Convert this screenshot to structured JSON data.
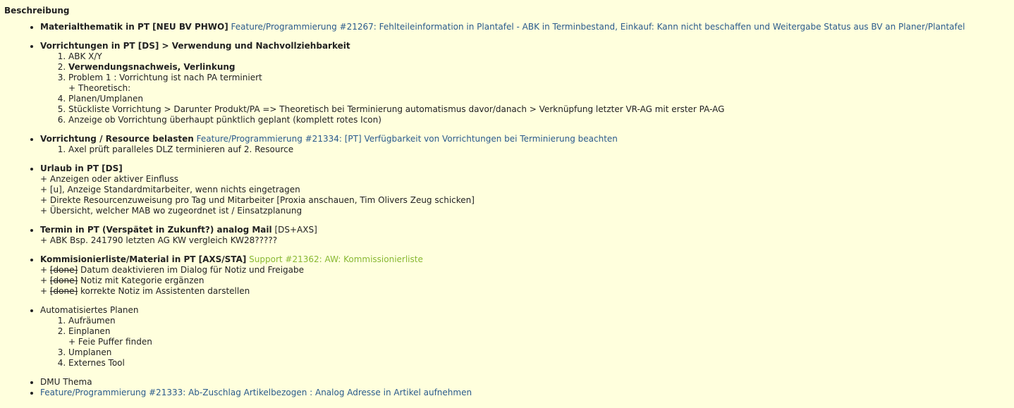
{
  "heading": "Beschreibung",
  "colors": {
    "background": "#ffffdd",
    "link": "#2a5a8c",
    "support_link": "#88b832",
    "text": "#222222"
  },
  "items": [
    {
      "bold": "Materialthematik in PT [NEU BV PHWO]",
      "link": "Feature/Programmierung #21267: Fehlteileinformation in Plantafel - ABK in Terminbestand, Einkauf: Kann nicht beschaffen und Weitergabe Status aus BV an Planer/Plantafel"
    },
    {
      "bold": "Vorrichtungen in PT [DS] > Verwendung und Nachvollziehbarkeit",
      "ol": [
        {
          "text": "ABK X/Y"
        },
        {
          "bold": "Verwendungsnachweis, Verlinkung"
        },
        {
          "text": "Problem 1 : Vorrichtung ist nach PA terminiert",
          "sub": "+ Theoretisch:"
        },
        {
          "text": "Planen/Umplanen"
        },
        {
          "text": "Stückliste Vorrichtung > Darunter Produkt/PA => Theoretisch bei Terminierung automatismus davor/danach > Verknüpfung letzter VR-AG mit erster PA-AG"
        },
        {
          "text": "Anzeige ob Vorrichtung überhaupt pünktlich geplant (komplett rotes Icon)"
        }
      ]
    },
    {
      "bold": "Vorrichtung / Resource belasten",
      "link": "Feature/Programmierung #21334: [PT] Verfügbarkeit von Vorrichtungen bei Terminierung beachten",
      "ol": [
        {
          "text": "Axel prüft paralleles DLZ terminieren auf 2. Resource"
        }
      ]
    },
    {
      "bold": "Urlaub in PT [DS]",
      "lines": [
        "+ Anzeigen oder aktiver Einfluss",
        "+ [u], Anzeige Standardmitarbeiter, wenn nichts eingetragen",
        "+ Direkte Resourcenzuweisung pro Tag und Mitarbeiter [Proxia anschauen, Tim Olivers Zeug schicken]",
        "+ Übersicht, welcher MAB wo zugeordnet ist / Einsatzplanung"
      ]
    },
    {
      "bold": "Termin in PT (Verspätet in Zukunft?) analog Mail",
      "suffix": "[DS+AXS]",
      "lines": [
        "+ ABK Bsp. 241790 letzten AG KW vergleich KW28?????"
      ]
    },
    {
      "bold": "Kommisionierliste/Material in PT [AXS/STA]",
      "support_link": "Support #21362: AW: Kommissionierliste",
      "done_lines": [
        {
          "prefix": "+ ",
          "done": "[done]",
          "text": " Datum deaktivieren im Dialog für Notiz und Freigabe"
        },
        {
          "prefix": "+ ",
          "done": "[done]",
          "text": " Notiz mit Kategorie ergänzen"
        },
        {
          "prefix": "+ ",
          "done": "[done]",
          "text": " korrekte Notiz im Assistenten darstellen"
        }
      ]
    },
    {
      "text": "Automatisiertes Planen",
      "ol": [
        {
          "text": "Aufräumen"
        },
        {
          "text": "Einplanen",
          "sub": "+ Feie Puffer finden"
        },
        {
          "text": "Umplanen"
        },
        {
          "text": "Externes Tool"
        }
      ]
    },
    {
      "text": "DMU Thema"
    },
    {
      "link": "Feature/Programmierung #21333: Ab-Zuschlag Artikelbezogen : Analog Adresse in Artikel aufnehmen"
    }
  ]
}
